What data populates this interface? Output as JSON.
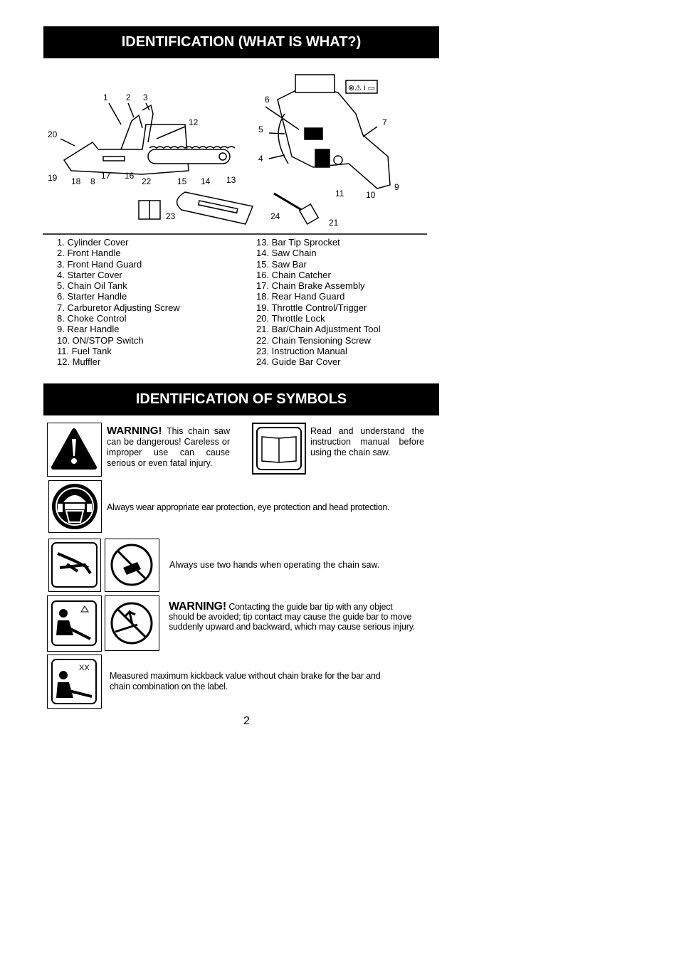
{
  "section1": {
    "title": "IDENTIFICATION (WHAT IS WHAT?)"
  },
  "diagram": {
    "callouts": [
      "1",
      "2",
      "3",
      "4",
      "5",
      "6",
      "7",
      "8",
      "9",
      "10",
      "11",
      "12",
      "13",
      "14",
      "15",
      "16",
      "17",
      "18",
      "19",
      "20",
      "21",
      "22",
      "23",
      "24"
    ],
    "label_symbols": "⊗⚠ i ▭"
  },
  "parts_left": [
    "1.   Cylinder Cover",
    "2.   Front Handle",
    "3.   Front Hand Guard",
    "4.   Starter Cover",
    "5.   Chain Oil Tank",
    "6.   Starter Handle",
    "7.   Carburetor Adjusting Screw",
    "8.   Choke Control",
    "9.   Rear Handle",
    "10. ON/STOP Switch",
    "11.  Fuel Tank",
    "12.  Muffler"
  ],
  "parts_right": [
    "13.  Bar Tip Sprocket",
    "14.  Saw Chain",
    "15.  Saw Bar",
    "16.  Chain Catcher",
    "17.  Chain Brake Assembly",
    "18.  Rear Hand Guard",
    "19.  Throttle Control/Trigger",
    "20.  Throttle Lock",
    "21.  Bar/Chain Adjustment Tool",
    "22.  Chain Tensioning Screw",
    "23.  Instruction Manual",
    "24.  Guide Bar Cover"
  ],
  "section2": {
    "title": "IDENTIFICATION OF SYMBOLS"
  },
  "symbols": {
    "warning_label": "WARNING!",
    "danger_text": "This chain saw can be dangerous! Careless or improper use can cause serious or even fatal injury.",
    "manual_text": "Read and understand the instruction manual before using the chain saw.",
    "protection_text": "Always wear appropriate ear protection, eye protection and head protection.",
    "two_hands_text": "Always use two hands when operating the chain saw.",
    "kickback_warning_label": "WARNING!",
    "kickback_text": "Contacting the guide bar tip with any object should be avoided; tip contact may cause the guide bar to move suddenly upward and backward, which may cause serious injury.",
    "kickback_value_mark": "XX",
    "kickback_value_text": "Measured maximum kickback value without chain brake for the bar and chain combination on the label."
  },
  "page_number": "2"
}
